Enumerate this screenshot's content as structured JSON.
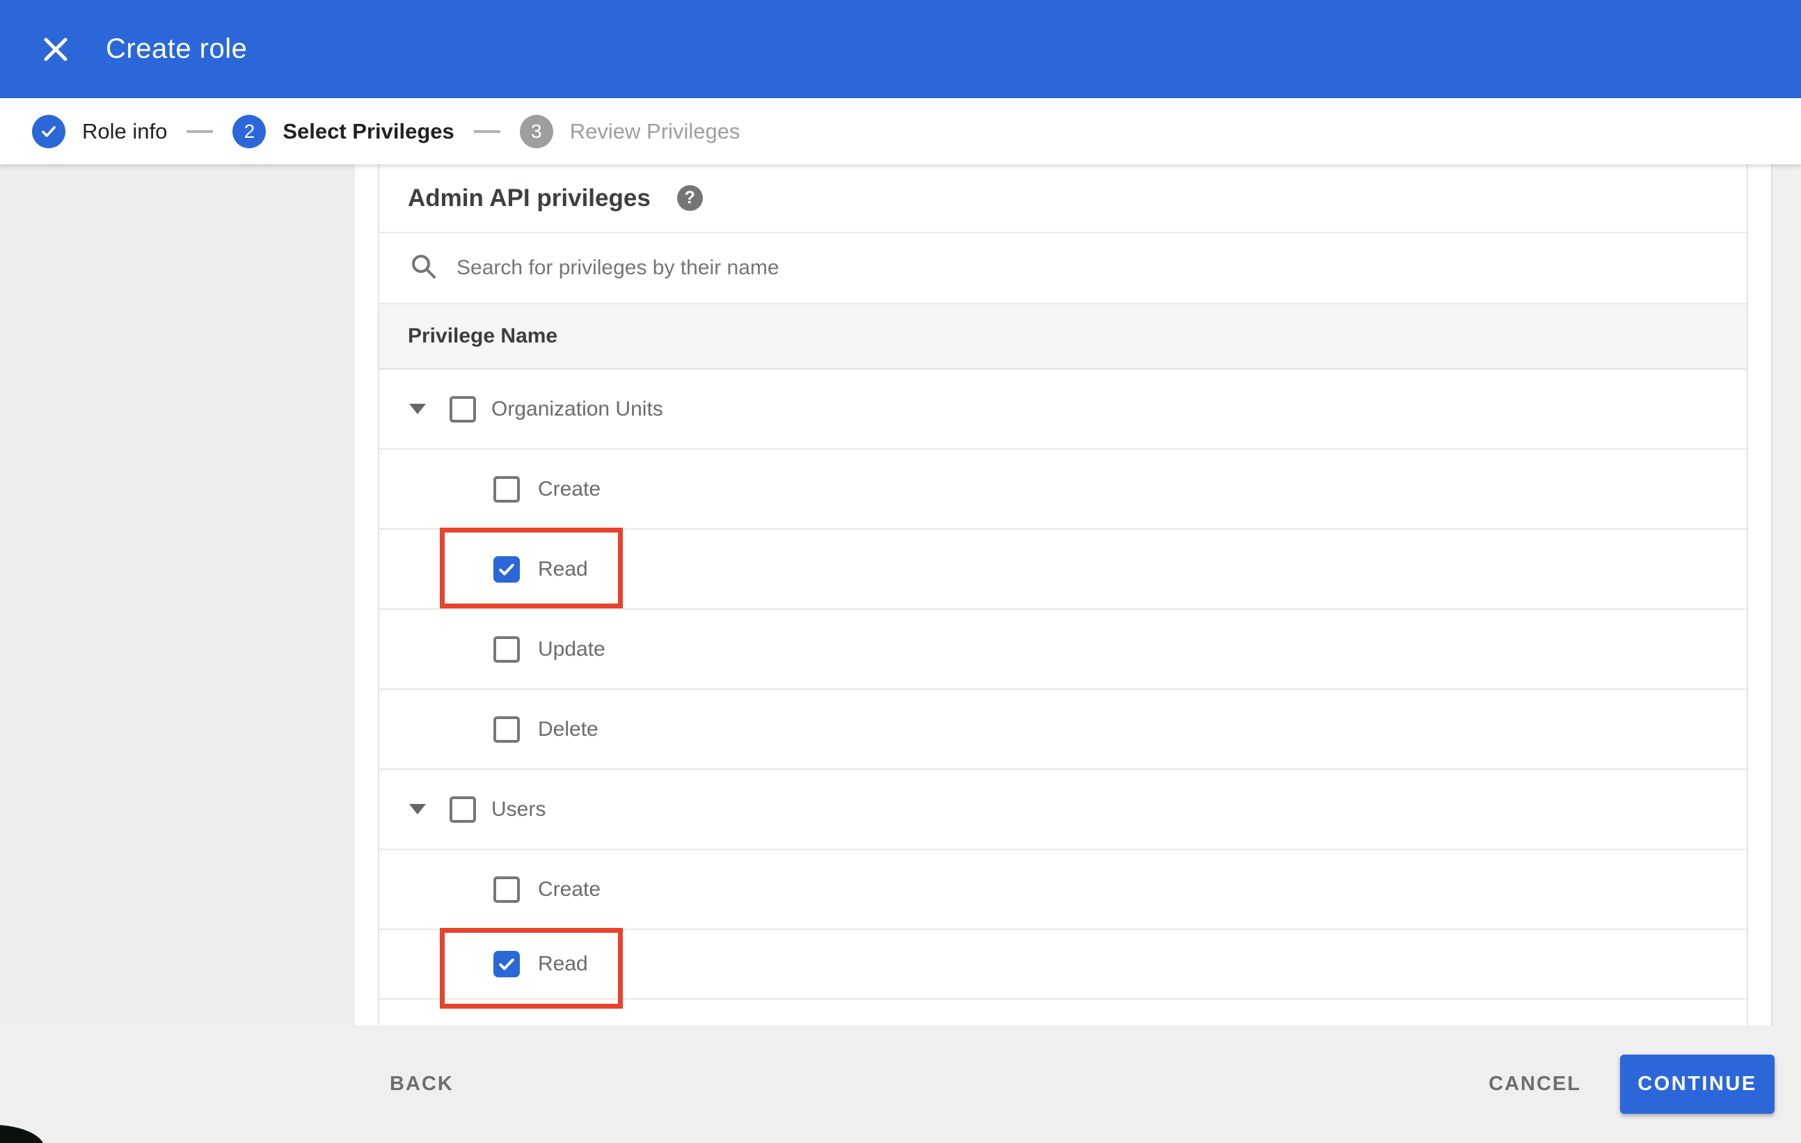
{
  "header": {
    "title": "Create role",
    "close_icon": "x-icon",
    "bar_color": "#2b67d9"
  },
  "stepper": {
    "steps": [
      {
        "label": "Role info",
        "state": "completed",
        "icon": "check-icon"
      },
      {
        "label": "Select Privileges",
        "state": "active",
        "number": "2"
      },
      {
        "label": "Review Privileges",
        "state": "upcoming",
        "number": "3"
      }
    ]
  },
  "content": {
    "heading": "Admin API privileges",
    "help_icon": "question-mark-icon",
    "help_glyph": "?",
    "search": {
      "placeholder": "Search for privileges by their name",
      "value": "",
      "icon": "search-icon"
    },
    "table": {
      "header": "Privilege Name",
      "rows": [
        {
          "label": "Organization Units",
          "type": "group",
          "checked": false,
          "expanded": true,
          "highlighted": false
        },
        {
          "label": "Create",
          "type": "child",
          "checked": false,
          "highlighted": false
        },
        {
          "label": "Read",
          "type": "child",
          "checked": true,
          "highlighted": true
        },
        {
          "label": "Update",
          "type": "child",
          "checked": false,
          "highlighted": false
        },
        {
          "label": "Delete",
          "type": "child",
          "checked": false,
          "highlighted": false
        },
        {
          "label": "Users",
          "type": "group",
          "checked": false,
          "expanded": true,
          "highlighted": false
        },
        {
          "label": "Create",
          "type": "child",
          "checked": false,
          "highlighted": false
        },
        {
          "label": "Read",
          "type": "child",
          "checked": true,
          "highlighted": true
        }
      ]
    }
  },
  "footer": {
    "back_label": "BACK",
    "cancel_label": "CANCEL",
    "continue_label": "CONTINUE"
  },
  "colors": {
    "primary_blue": "#2b67d9",
    "highlight_red": "#e8432b",
    "footer_gray": "#efefef",
    "table_header_gray": "#f5f5f5"
  }
}
